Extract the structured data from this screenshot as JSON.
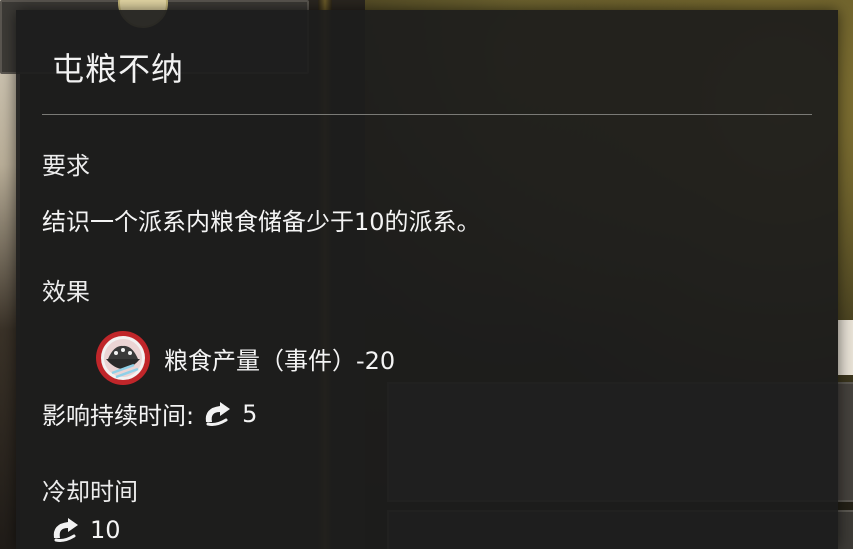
{
  "tooltip": {
    "title": "屯粮不纳",
    "requirement_label": "要求",
    "requirement_text": "结识一个派系内粮食储备少于10的派系。",
    "effect_label": "效果",
    "effect": {
      "icon": "rice-bowl-icon",
      "text": "粮食产量（事件）-20"
    },
    "duration_label": "影响持续时间:",
    "duration_value": "5",
    "cooldown_label": "冷却时间",
    "cooldown_value": "10"
  },
  "colors": {
    "panel_bg": "#1c1c1c",
    "text": "#f4f4f4",
    "icon_ring": "#c0262a"
  }
}
